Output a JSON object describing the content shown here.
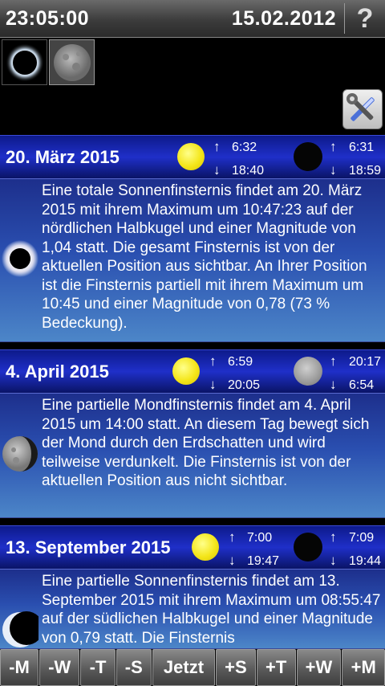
{
  "header": {
    "time": "23:05:00",
    "date": "15.02.2012",
    "help_label": "?"
  },
  "thumbnails": [
    {
      "icon": "solar-eclipse-icon",
      "selected": false
    },
    {
      "icon": "lunar-eclipse-icon",
      "selected": true
    }
  ],
  "tools_icon": "wrench-screwdriver-icon",
  "entries": [
    {
      "date": "20. März 2015",
      "sun_rise": "6:32",
      "sun_set": "18:40",
      "moon_rise": "6:31",
      "moon_set": "18:59",
      "moon_phase": "new",
      "eclipse_type": "solar-total",
      "text": "Eine totale Sonnenfinsternis findet am 20. März 2015 mit ihrem Maximum um 10:47:23 auf der nördlichen Halbkugel und einer Magnitude von 1,04 statt. Die gesamt Finsternis ist von der aktuellen Position aus sichtbar.  An Ihrer Position ist die Finsternis partiell mit ihrem Maximum um 10:45 und einer Magnitude von 0,78 (73 % Bedeckung)."
    },
    {
      "date": "4. April 2015",
      "sun_rise": "6:59",
      "sun_set": "20:05",
      "moon_rise": "20:17",
      "moon_set": "6:54",
      "moon_phase": "full",
      "eclipse_type": "lunar-partial",
      "text": "Eine partielle Mondfinsternis findet am 4. April 2015 um 14:00 statt. An diesem Tag bewegt sich der Mond durch den Erdschatten und wird teilweise verdunkelt. Die Finsternis ist von der aktuellen Position aus nicht sichtbar."
    },
    {
      "date": "13. September 2015",
      "sun_rise": "7:00",
      "sun_set": "19:47",
      "moon_rise": "7:09",
      "moon_set": "19:44",
      "moon_phase": "new",
      "eclipse_type": "solar-partial",
      "text": "Eine partielle Sonnenfinsternis findet am 13. September 2015 mit ihrem Maximum um 08:55:47 auf der südlichen Halbkugel und einer Magnitude von 0,79 statt. Die Finsternis"
    }
  ],
  "arrows": {
    "up": "↑",
    "down": "↓"
  },
  "bottom_buttons": [
    "-M",
    "-W",
    "-T",
    "-S",
    "Jetzt",
    "+S",
    "+T",
    "+W",
    "+M"
  ]
}
